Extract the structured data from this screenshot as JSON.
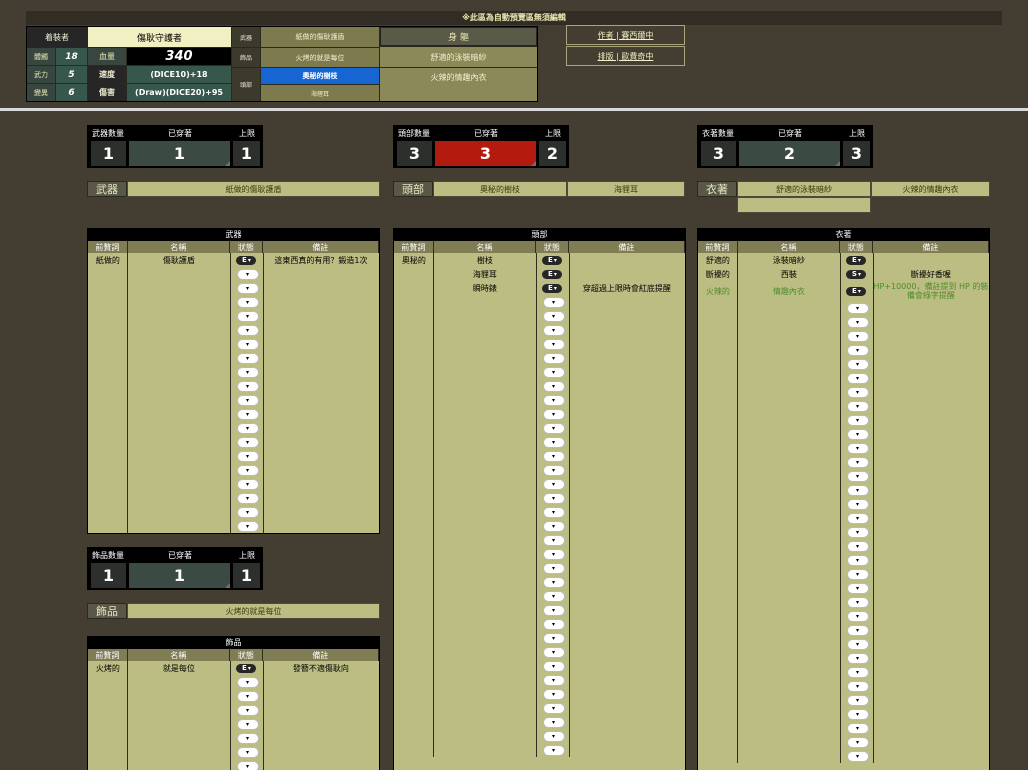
{
  "notice": "※此區為自動預覽區無須編輯",
  "preview": {
    "wearer_label": "着裝者",
    "wearer_name": "傷耿守護者",
    "stats": [
      {
        "label": "體觸",
        "value": "18"
      },
      {
        "label": "武力",
        "value": "5"
      },
      {
        "label": "變異",
        "value": "6"
      }
    ],
    "hp_label": "血量",
    "hp_value": "340",
    "speed_label": "速度",
    "speed_value": "(DICE10)+18",
    "damage_label": "傷害",
    "damage_value": "(Draw)(DICE20)+95",
    "weapon_label": "武器",
    "weapon_item": "紙做的傷耿護盾",
    "accessory_label": "飾品",
    "accessory_item": "火烤的就是每位",
    "head_label": "頭部",
    "head_items": [
      "奧秘的樹枝",
      "海貍耳"
    ],
    "body_label": "身 軀",
    "body_items": [
      "舒適的泳裝暗紗",
      "火辣的情趣內衣"
    ]
  },
  "links": [
    {
      "label": "作者 | 賽西爾中"
    },
    {
      "label": "排版 | 歐費奇中"
    }
  ],
  "counters": {
    "weapon": {
      "count_label": "武器數量",
      "worn_label": "已穿著",
      "max_label": "上限",
      "count": "1",
      "worn": "1",
      "max": "1",
      "status": "normal"
    },
    "head": {
      "count_label": "頭部數量",
      "worn_label": "已穿著",
      "max_label": "上限",
      "count": "3",
      "worn": "3",
      "max": "2",
      "status": "over"
    },
    "body": {
      "count_label": "衣著數量",
      "worn_label": "已穿著",
      "max_label": "上限",
      "count": "3",
      "worn": "2",
      "max": "3",
      "status": "normal"
    },
    "accessory": {
      "count_label": "飾品數量",
      "worn_label": "已穿著",
      "max_label": "上限",
      "count": "1",
      "worn": "1",
      "max": "1",
      "status": "normal"
    }
  },
  "equipped": {
    "weapon": {
      "label": "武器",
      "items": [
        "紙做的傷耿護盾"
      ]
    },
    "head": {
      "label": "頭部",
      "items": [
        "奧秘的樹枝",
        "海貍耳"
      ]
    },
    "body": {
      "label": "衣著",
      "items": [
        "舒適的泳裝暗紗",
        "火辣的情趣內衣"
      ]
    },
    "accessory": {
      "label": "飾品",
      "items": [
        "火烤的就是每位"
      ]
    }
  },
  "colors": {
    "over_limit": "#b21b0e",
    "table_bg": "#bbbd83",
    "header_bg": "#807d55",
    "green_note": "#4d8d2a"
  },
  "tables": {
    "columns": [
      "前贅詞",
      "名稱",
      "狀態",
      "備註"
    ],
    "weapon": {
      "title": "武器",
      "rows": [
        {
          "prefix": "紙做的",
          "name": "傷耿護盾",
          "state": "E",
          "note": "這東西真的有用？鍛造1次"
        }
      ],
      "empty_rows": 19
    },
    "head": {
      "title": "頭部",
      "rows": [
        {
          "prefix": "奧秘的",
          "name": "樹枝",
          "state": "E",
          "note": ""
        },
        {
          "prefix": "",
          "name": "海貍耳",
          "state": "E",
          "note": ""
        },
        {
          "prefix": "",
          "name": "瞬時錶",
          "state": "E",
          "note": "穿超過上限時會紅底提醒"
        }
      ],
      "empty_rows": 33
    },
    "body": {
      "title": "衣著",
      "rows": [
        {
          "prefix": "舒適的",
          "name": "泳裝暗紗",
          "state": "E",
          "note": ""
        },
        {
          "prefix": "斷擾的",
          "name": "西裝",
          "state": "S",
          "note": "斷擾好香喔"
        },
        {
          "prefix": "火辣的",
          "name": "情趣內衣",
          "state": "E",
          "note": "HP+10000，備註提到 HP 的裝備會綠字提醒",
          "green": true
        }
      ],
      "empty_rows": 33
    },
    "accessory": {
      "title": "飾品",
      "rows": [
        {
          "prefix": "火烤的",
          "name": "就是每位",
          "state": "E",
          "note": "發簪不適傷耿向"
        }
      ],
      "empty_rows": 7
    }
  }
}
